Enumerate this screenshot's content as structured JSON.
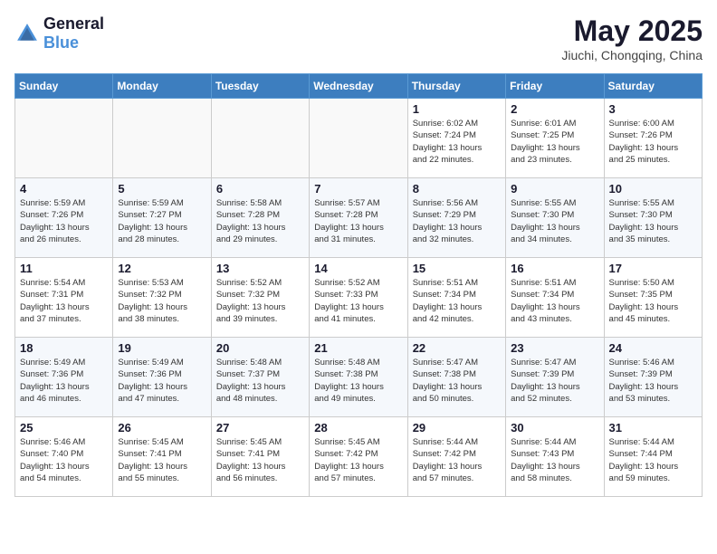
{
  "logo": {
    "general": "General",
    "blue": "Blue"
  },
  "header": {
    "month": "May 2025",
    "location": "Jiuchi, Chongqing, China"
  },
  "weekdays": [
    "Sunday",
    "Monday",
    "Tuesday",
    "Wednesday",
    "Thursday",
    "Friday",
    "Saturday"
  ],
  "weeks": [
    [
      {
        "day": "",
        "info": ""
      },
      {
        "day": "",
        "info": ""
      },
      {
        "day": "",
        "info": ""
      },
      {
        "day": "",
        "info": ""
      },
      {
        "day": "1",
        "info": "Sunrise: 6:02 AM\nSunset: 7:24 PM\nDaylight: 13 hours\nand 22 minutes."
      },
      {
        "day": "2",
        "info": "Sunrise: 6:01 AM\nSunset: 7:25 PM\nDaylight: 13 hours\nand 23 minutes."
      },
      {
        "day": "3",
        "info": "Sunrise: 6:00 AM\nSunset: 7:26 PM\nDaylight: 13 hours\nand 25 minutes."
      }
    ],
    [
      {
        "day": "4",
        "info": "Sunrise: 5:59 AM\nSunset: 7:26 PM\nDaylight: 13 hours\nand 26 minutes."
      },
      {
        "day": "5",
        "info": "Sunrise: 5:59 AM\nSunset: 7:27 PM\nDaylight: 13 hours\nand 28 minutes."
      },
      {
        "day": "6",
        "info": "Sunrise: 5:58 AM\nSunset: 7:28 PM\nDaylight: 13 hours\nand 29 minutes."
      },
      {
        "day": "7",
        "info": "Sunrise: 5:57 AM\nSunset: 7:28 PM\nDaylight: 13 hours\nand 31 minutes."
      },
      {
        "day": "8",
        "info": "Sunrise: 5:56 AM\nSunset: 7:29 PM\nDaylight: 13 hours\nand 32 minutes."
      },
      {
        "day": "9",
        "info": "Sunrise: 5:55 AM\nSunset: 7:30 PM\nDaylight: 13 hours\nand 34 minutes."
      },
      {
        "day": "10",
        "info": "Sunrise: 5:55 AM\nSunset: 7:30 PM\nDaylight: 13 hours\nand 35 minutes."
      }
    ],
    [
      {
        "day": "11",
        "info": "Sunrise: 5:54 AM\nSunset: 7:31 PM\nDaylight: 13 hours\nand 37 minutes."
      },
      {
        "day": "12",
        "info": "Sunrise: 5:53 AM\nSunset: 7:32 PM\nDaylight: 13 hours\nand 38 minutes."
      },
      {
        "day": "13",
        "info": "Sunrise: 5:52 AM\nSunset: 7:32 PM\nDaylight: 13 hours\nand 39 minutes."
      },
      {
        "day": "14",
        "info": "Sunrise: 5:52 AM\nSunset: 7:33 PM\nDaylight: 13 hours\nand 41 minutes."
      },
      {
        "day": "15",
        "info": "Sunrise: 5:51 AM\nSunset: 7:34 PM\nDaylight: 13 hours\nand 42 minutes."
      },
      {
        "day": "16",
        "info": "Sunrise: 5:51 AM\nSunset: 7:34 PM\nDaylight: 13 hours\nand 43 minutes."
      },
      {
        "day": "17",
        "info": "Sunrise: 5:50 AM\nSunset: 7:35 PM\nDaylight: 13 hours\nand 45 minutes."
      }
    ],
    [
      {
        "day": "18",
        "info": "Sunrise: 5:49 AM\nSunset: 7:36 PM\nDaylight: 13 hours\nand 46 minutes."
      },
      {
        "day": "19",
        "info": "Sunrise: 5:49 AM\nSunset: 7:36 PM\nDaylight: 13 hours\nand 47 minutes."
      },
      {
        "day": "20",
        "info": "Sunrise: 5:48 AM\nSunset: 7:37 PM\nDaylight: 13 hours\nand 48 minutes."
      },
      {
        "day": "21",
        "info": "Sunrise: 5:48 AM\nSunset: 7:38 PM\nDaylight: 13 hours\nand 49 minutes."
      },
      {
        "day": "22",
        "info": "Sunrise: 5:47 AM\nSunset: 7:38 PM\nDaylight: 13 hours\nand 50 minutes."
      },
      {
        "day": "23",
        "info": "Sunrise: 5:47 AM\nSunset: 7:39 PM\nDaylight: 13 hours\nand 52 minutes."
      },
      {
        "day": "24",
        "info": "Sunrise: 5:46 AM\nSunset: 7:39 PM\nDaylight: 13 hours\nand 53 minutes."
      }
    ],
    [
      {
        "day": "25",
        "info": "Sunrise: 5:46 AM\nSunset: 7:40 PM\nDaylight: 13 hours\nand 54 minutes."
      },
      {
        "day": "26",
        "info": "Sunrise: 5:45 AM\nSunset: 7:41 PM\nDaylight: 13 hours\nand 55 minutes."
      },
      {
        "day": "27",
        "info": "Sunrise: 5:45 AM\nSunset: 7:41 PM\nDaylight: 13 hours\nand 56 minutes."
      },
      {
        "day": "28",
        "info": "Sunrise: 5:45 AM\nSunset: 7:42 PM\nDaylight: 13 hours\nand 57 minutes."
      },
      {
        "day": "29",
        "info": "Sunrise: 5:44 AM\nSunset: 7:42 PM\nDaylight: 13 hours\nand 57 minutes."
      },
      {
        "day": "30",
        "info": "Sunrise: 5:44 AM\nSunset: 7:43 PM\nDaylight: 13 hours\nand 58 minutes."
      },
      {
        "day": "31",
        "info": "Sunrise: 5:44 AM\nSunset: 7:44 PM\nDaylight: 13 hours\nand 59 minutes."
      }
    ]
  ]
}
